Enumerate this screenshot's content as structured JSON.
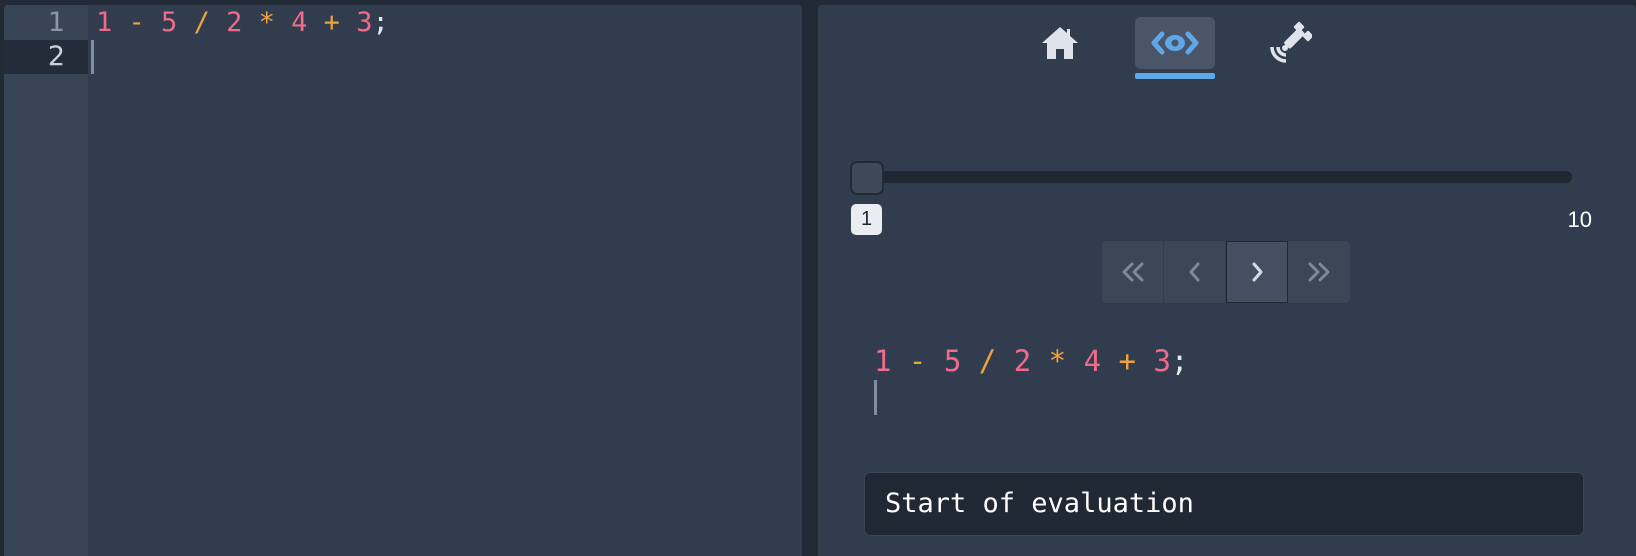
{
  "editor": {
    "line_numbers": [
      "1",
      "2"
    ],
    "active_line": 2,
    "code_tokens": [
      {
        "text": "1",
        "kind": "num"
      },
      {
        "text": " - ",
        "kind": "op"
      },
      {
        "text": "5",
        "kind": "num"
      },
      {
        "text": " / ",
        "kind": "op"
      },
      {
        "text": "2",
        "kind": "num"
      },
      {
        "text": " * ",
        "kind": "op"
      },
      {
        "text": "4",
        "kind": "num"
      },
      {
        "text": " + ",
        "kind": "op"
      },
      {
        "text": "3",
        "kind": "num"
      },
      {
        "text": ";",
        "kind": "punc"
      }
    ]
  },
  "tabs": [
    {
      "icon": "home-icon",
      "active": false
    },
    {
      "icon": "code-eye-icon",
      "active": true
    },
    {
      "icon": "satellite-dish-icon",
      "active": false
    }
  ],
  "stepper": {
    "min_label": "1",
    "max_label": "10",
    "current_step": 1
  },
  "pager": {
    "buttons": [
      {
        "icon": "double-chevron-left-icon"
      },
      {
        "icon": "chevron-left-icon"
      },
      {
        "icon": "chevron-right-icon"
      },
      {
        "icon": "double-chevron-right-icon"
      }
    ]
  },
  "trace": {
    "code_tokens": [
      {
        "text": "1",
        "kind": "num"
      },
      {
        "text": " - ",
        "kind": "op"
      },
      {
        "text": "5",
        "kind": "num"
      },
      {
        "text": " / ",
        "kind": "op"
      },
      {
        "text": "2",
        "kind": "num"
      },
      {
        "text": " * ",
        "kind": "op"
      },
      {
        "text": "4",
        "kind": "num"
      },
      {
        "text": " + ",
        "kind": "op"
      },
      {
        "text": "3",
        "kind": "num"
      },
      {
        "text": ";",
        "kind": "punc"
      }
    ]
  },
  "status_text": "Start of evaluation",
  "colors": {
    "number": "#f06b8a",
    "operator": "#f0a23a",
    "accent": "#5ea8e8"
  }
}
